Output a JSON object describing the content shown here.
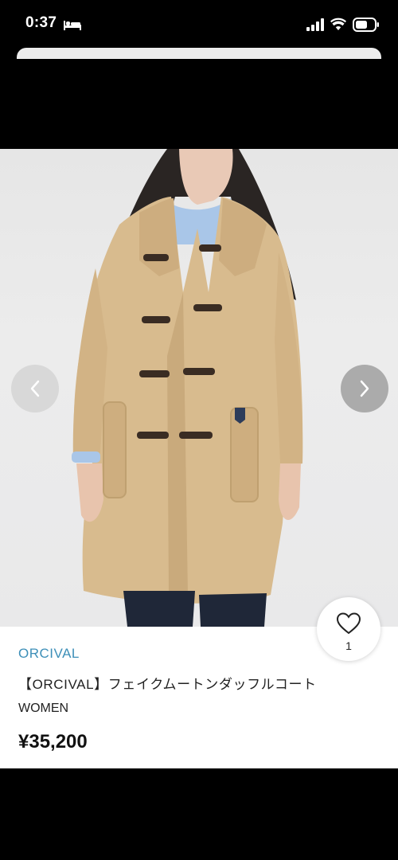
{
  "status_bar": {
    "time": "0:37",
    "icons": [
      "bed-icon",
      "signal-icon",
      "wifi-icon",
      "battery-icon"
    ]
  },
  "product": {
    "brand": "ORCIVAL",
    "name": "【ORCIVAL】フェイクムートンダッフルコート",
    "category": "WOMEN",
    "price": "¥35,200"
  },
  "favorite": {
    "count": "1",
    "icon": "heart-icon"
  },
  "carousel": {
    "prev_icon": "chevron-left-icon",
    "next_icon": "chevron-right-icon"
  },
  "colors": {
    "brand_link": "#3d8fb8",
    "coat": "#d8bb8e",
    "background": "#000000"
  }
}
